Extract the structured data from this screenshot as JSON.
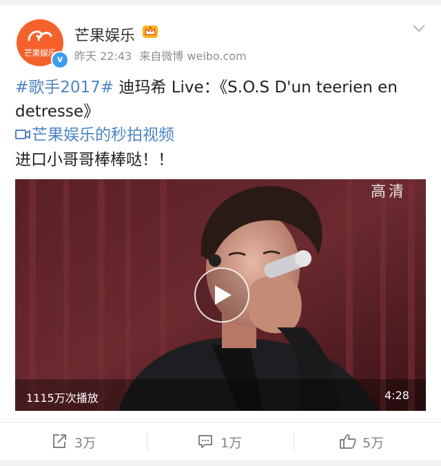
{
  "post": {
    "author": {
      "name": "芒果娱乐",
      "avatar_text": "芒果娱乐",
      "verified": true
    },
    "meta": {
      "time": "昨天 22:43",
      "source": "来自微博 weibo.com"
    },
    "content": {
      "hashtag": "#歌手2017#",
      "line1_rest": " 迪玛希 Live：《S.O.S D'un teerien en",
      "line2": "detresse》",
      "video_link": "芒果娱乐的秒拍视频",
      "line4": "进口小哥哥棒棒哒！！"
    },
    "video": {
      "quality_label": "高清",
      "play_count": "1115万次播放",
      "duration": "4:28"
    },
    "actions": {
      "repost_count": "3万",
      "comment_count": "1万",
      "like_count": "5万"
    }
  },
  "icons": {
    "crown": "crown-icon",
    "chevron": "chevron-down-icon",
    "video_link": "video-camera-icon",
    "play": "play-icon",
    "repost": "repost-icon",
    "comment": "comment-icon",
    "like": "thumbs-up-icon"
  },
  "colors": {
    "link": "#4e84c4",
    "brand": "#f5612b",
    "verified": "#3d9bf0"
  }
}
